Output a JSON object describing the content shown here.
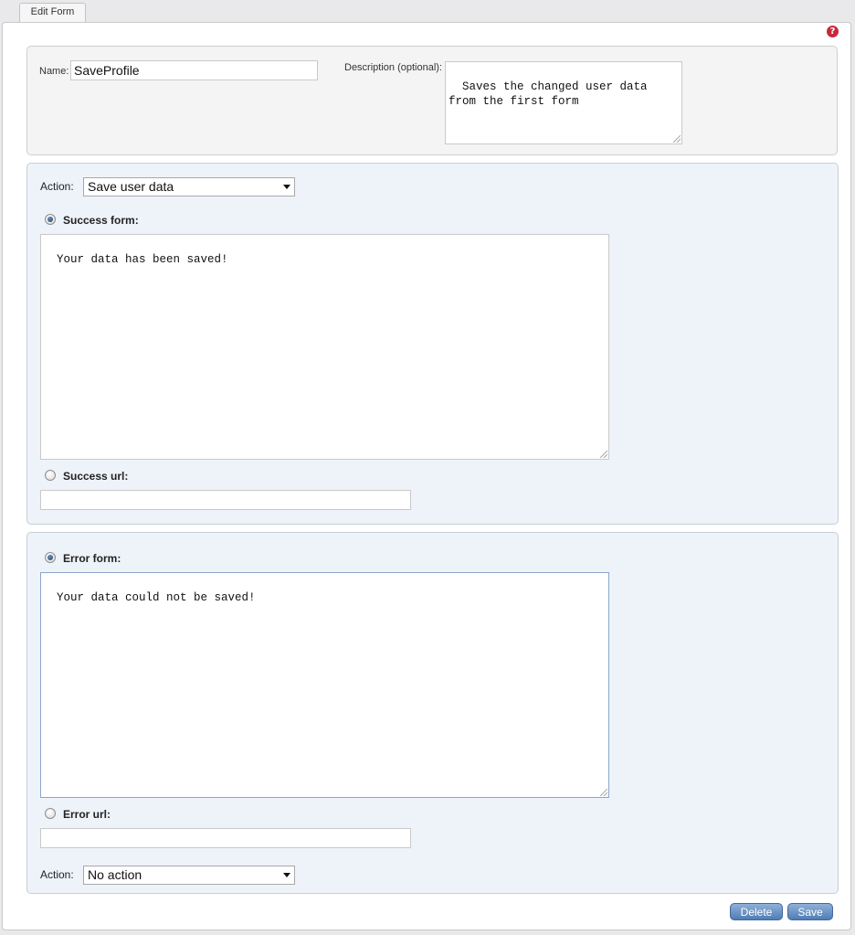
{
  "tabs": {
    "edit_form": "Edit Form"
  },
  "header": {
    "help_icon": "?"
  },
  "general": {
    "name_label": "Name:",
    "name_value": "SaveProfile",
    "description_label": "Description (optional):",
    "description_value": "Saves the changed user data\nfrom the first form"
  },
  "success": {
    "action_label": "Action:",
    "action_value": "Save user data",
    "form_label": "Success form:",
    "form_selected": true,
    "form_text": "Your data has been saved!",
    "url_label": "Success url:",
    "url_selected": false,
    "url_value": ""
  },
  "error": {
    "form_label": "Error form:",
    "form_selected": true,
    "form_text": "Your data could not be saved!",
    "url_label": "Error url:",
    "url_selected": false,
    "url_value": "",
    "action_label": "Action:",
    "action_value": "No action"
  },
  "footer": {
    "delete_label": "Delete",
    "save_label": "Save"
  },
  "colors": {
    "panel_blue": "#eef3fa",
    "button_blue": "#4f7db4",
    "help_red": "#c8283c"
  }
}
